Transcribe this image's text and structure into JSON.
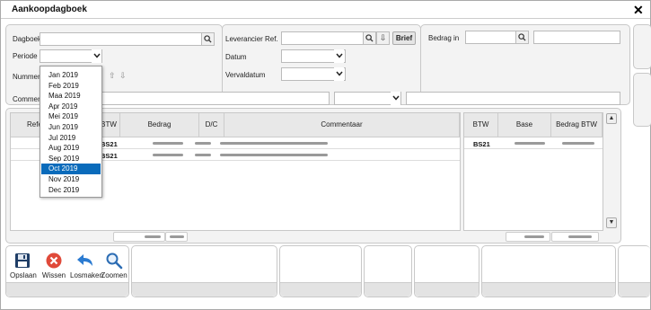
{
  "window": {
    "title": "Aankoopdagboek"
  },
  "form": {
    "dagboek_label": "Dagboek",
    "periode_label": "Periode",
    "nummer_label": "Nummer",
    "commentaar_label": "Commentaar",
    "leverancier_label": "Leverancier Ref.",
    "brief_label": "Brief",
    "datum_label": "Datum",
    "vervaldatum_label": "Vervaldatum",
    "bedrag_in_label": "Bedrag in",
    "dagboek_value": "",
    "leverancier_value": "",
    "bedrag_in_value": ""
  },
  "periode_dropdown": {
    "options": [
      "Jan 2019",
      "Feb 2019",
      "Maa 2019",
      "Apr 2019",
      "Mei 2019",
      "Jun 2019",
      "Jul 2019",
      "Aug 2019",
      "Sep 2019",
      "Oct 2019",
      "Nov 2019",
      "Dec 2019"
    ],
    "selected": "Oct 2019"
  },
  "main_grid": {
    "columns": [
      "Refe",
      "BTW",
      "Bedrag",
      "D/C",
      "Commentaar"
    ],
    "rows": [
      {
        "btw": "BS21"
      },
      {
        "btw": "BS21"
      }
    ]
  },
  "btw_grid": {
    "columns": [
      "BTW",
      "Base",
      "Bedrag BTW"
    ],
    "rows": [
      {
        "btw": "BS21"
      }
    ]
  },
  "toolbar": {
    "save_label": "Opslaan",
    "delete_label": "Wissen",
    "unlink_label": "Losmaken",
    "zoom_label": "Zoomen"
  },
  "colors": {
    "selection": "#0a6bbb",
    "delete_red": "#e04a3a",
    "save_navy": "#1f3d66",
    "arrow_blue": "#2b7bd1"
  },
  "icons": [
    "search-icon",
    "download-icon",
    "chevron-down-icon",
    "arrow-up-icon",
    "arrow-down-icon",
    "close-icon",
    "save-icon",
    "delete-icon",
    "undo-arrow-icon",
    "zoom-icon"
  ]
}
